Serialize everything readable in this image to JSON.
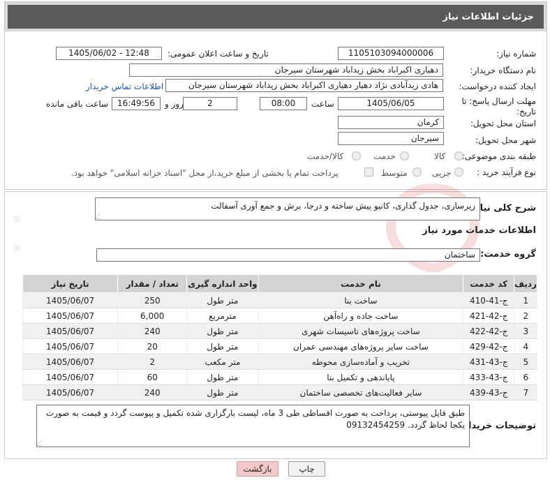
{
  "header": {
    "title": "جزئیات اطلاعات نیاز"
  },
  "fields": {
    "need_number_label": "شماره نیاز:",
    "need_number": "1105103094000006",
    "announce_label": "تاریخ و ساعت اعلان عمومی:",
    "announce_value": "1405/06/02 - 12:48",
    "buyer_org_label": "نام دستگاه خریدار:",
    "buyer_org": "دهیاری اکبراباد بخش زیداباد شهرستان سیرجان",
    "requester_label": "ایجاد کننده درخواست:",
    "requester": "هادی زیدآبادی نژاد دهیار دهیاری اکبراباد بخش زیداباد شهرستان سیرجان",
    "contact_link": "اطلاعات تماس خریدار",
    "deadline_label": "مهلت ارسال پاسخ: تا تاریخ:",
    "deadline_date": "1405/06/05",
    "time_label": "ساعت",
    "deadline_time": "08:00",
    "days_value": "2",
    "days_label": "روز و",
    "remaining_time": "16:49:56",
    "remaining_label": "ساعت باقی مانده",
    "province_label": "استان محل تحویل:",
    "province": "کرمان",
    "city_label": "شهر محل تحویل:",
    "city": "سیرجان",
    "category_label": "طبقه بندی موضوعی:",
    "category_options": [
      "کالا",
      "خدمت",
      "کالا/خدمت"
    ],
    "process_label": "نوع فرآیند خرید :",
    "process_options": [
      "جزیی",
      "متوسط"
    ],
    "treasury_note": "پرداخت تمام یا بخشی از مبلغ خرید،از محل \"اسناد خزانه اسلامی\" خواهد بود."
  },
  "summary": {
    "label": "شرح کلی نیاز:",
    "text": "زیرسازی، جدول گذاری، کانیو پیش ساخته و درجا، برش و جمع آوری آسفالت"
  },
  "services": {
    "section_title": "اطلاعات خدمات مورد نیاز",
    "group_label": "گروه خدمت:",
    "group_value": "ساختمان",
    "columns": [
      "ردیف",
      "کد خدمت",
      "نام خدمت",
      "واحد اندازه گیری",
      "تعداد / مقدار",
      "تاریخ نیاز"
    ],
    "rows": [
      [
        "1",
        "ج-41-410",
        "ساخت بنا",
        "متر طول",
        "250",
        "1405/06/07"
      ],
      [
        "2",
        "ج-42-421",
        "ساخت جاده و راه‌آهن",
        "مترمربع",
        "6,000",
        "1405/06/07"
      ],
      [
        "3",
        "ج-42-422",
        "ساخت پروژه‌های تاسیسات شهری",
        "متر طول",
        "240",
        "1405/06/07"
      ],
      [
        "4",
        "ج-42-429",
        "ساخت سایر پروژه‌های مهندسی عمران",
        "متر طول",
        "20",
        "1405/06/07"
      ],
      [
        "5",
        "ج-43-431",
        "تخریب و آماده‌سازی محوطه",
        "متر مکعب",
        "2",
        "1405/06/07"
      ],
      [
        "6",
        "ج-43-433",
        "پایاندهی و تکمیل بنا",
        "متر طول",
        "60",
        "1405/06/07"
      ],
      [
        "7",
        "ج-43-439",
        "سایر فعالیت‌های تخصصی ساختمان",
        "متر طول",
        "240",
        "1405/06/07"
      ]
    ]
  },
  "notes": {
    "label": "توضیحات خریدار:",
    "text": "طبق فایل پیوستی، پرداخت به صورت اقساطی طی 3 ماه، لیست بارگزاری شده تکمیل و پیوست گردد و قیمت به صورت یکجا لحاظ گردد. 09132454259"
  },
  "buttons": {
    "print": "چاپ",
    "back": "بازگشت"
  },
  "colors": {
    "header_bg": "#5a5a5a",
    "link": "#1a56b0",
    "back_btn": "#f4c9c9"
  }
}
